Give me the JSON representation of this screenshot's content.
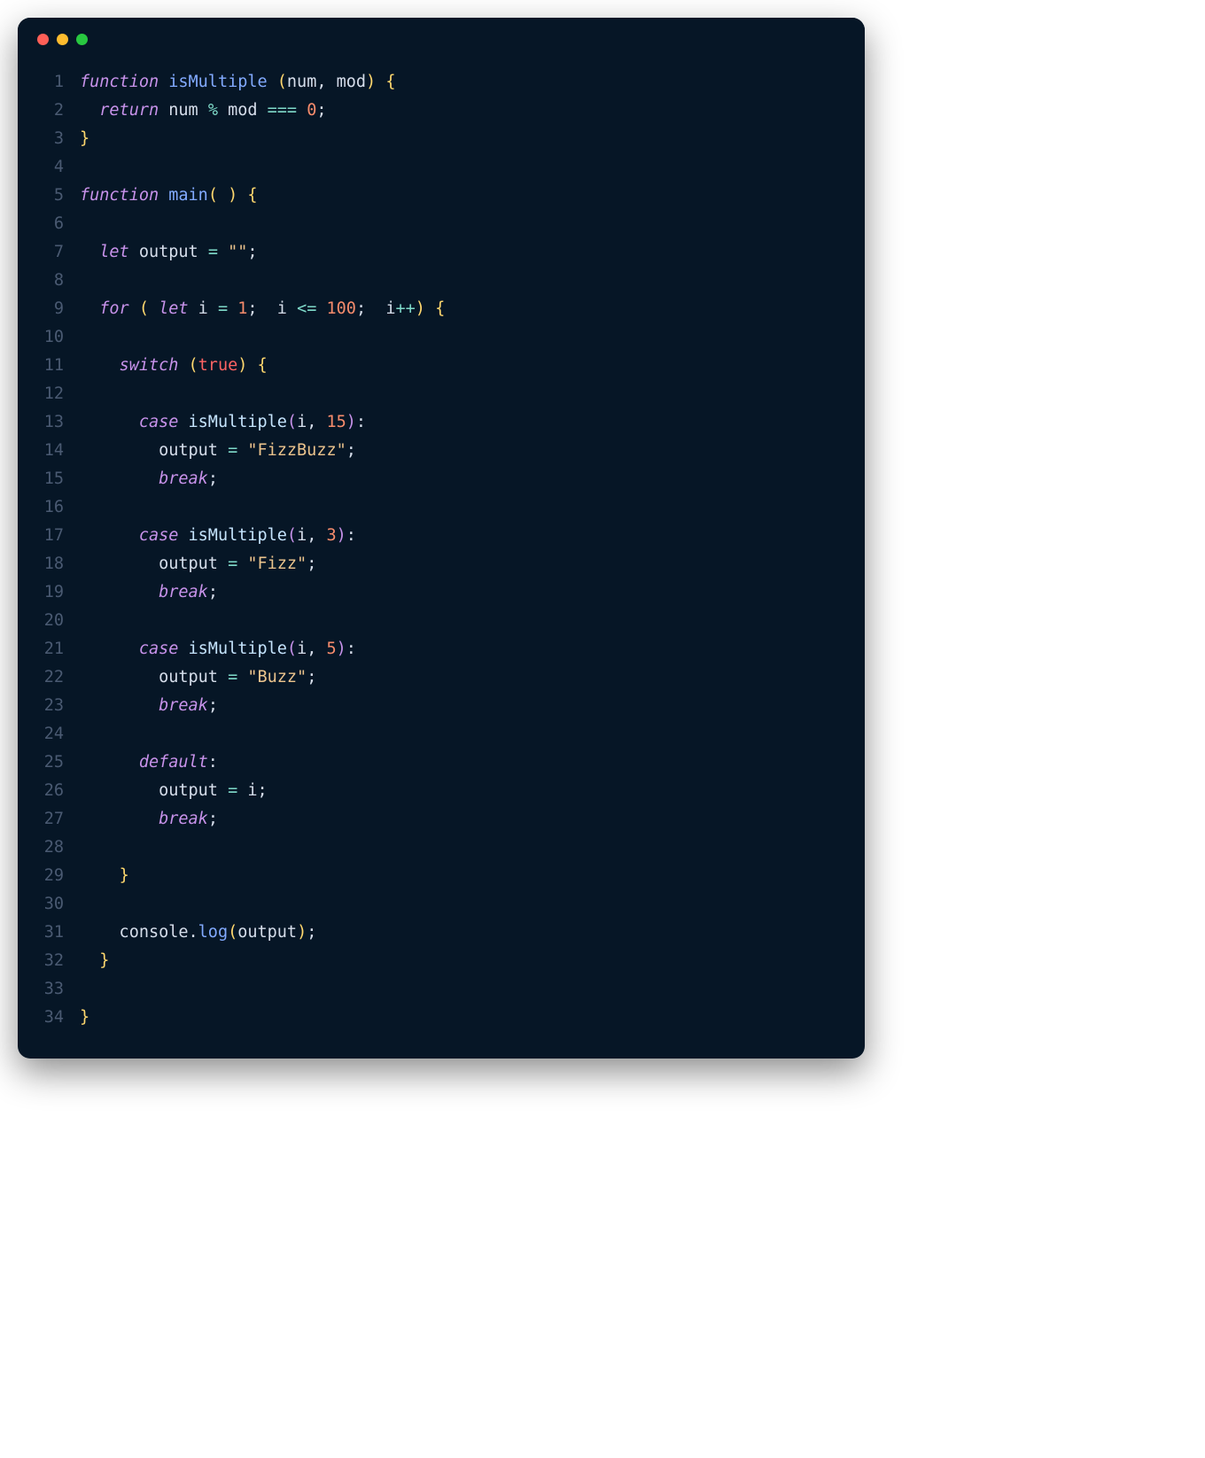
{
  "titlebar": {
    "buttons": [
      "close",
      "minimize",
      "zoom"
    ]
  },
  "code": {
    "language": "javascript",
    "lines": [
      {
        "n": 1,
        "tokens": [
          [
            "kw",
            "function"
          ],
          [
            "id",
            " "
          ],
          [
            "fn",
            "isMultiple"
          ],
          [
            "id",
            " "
          ],
          [
            "par",
            "("
          ],
          [
            "id",
            "num"
          ],
          [
            "punc",
            ", "
          ],
          [
            "id",
            "mod"
          ],
          [
            "par",
            ")"
          ],
          [
            "id",
            " "
          ],
          [
            "par",
            "{"
          ]
        ]
      },
      {
        "n": 2,
        "tokens": [
          [
            "id",
            "  "
          ],
          [
            "kw",
            "return"
          ],
          [
            "id",
            " num "
          ],
          [
            "op",
            "%"
          ],
          [
            "id",
            " mod "
          ],
          [
            "op",
            "==="
          ],
          [
            "id",
            " "
          ],
          [
            "num",
            "0"
          ],
          [
            "punc",
            ";"
          ]
        ]
      },
      {
        "n": 3,
        "tokens": [
          [
            "par",
            "}"
          ]
        ]
      },
      {
        "n": 4,
        "tokens": []
      },
      {
        "n": 5,
        "tokens": [
          [
            "kw",
            "function"
          ],
          [
            "id",
            " "
          ],
          [
            "fn",
            "main"
          ],
          [
            "par",
            "("
          ],
          [
            "id",
            " "
          ],
          [
            "par",
            ")"
          ],
          [
            "id",
            " "
          ],
          [
            "par",
            "{"
          ]
        ]
      },
      {
        "n": 6,
        "tokens": []
      },
      {
        "n": 7,
        "tokens": [
          [
            "id",
            "  "
          ],
          [
            "kw",
            "let"
          ],
          [
            "id",
            " output "
          ],
          [
            "op",
            "="
          ],
          [
            "id",
            " "
          ],
          [
            "str",
            "\"\""
          ],
          [
            "punc",
            ";"
          ]
        ]
      },
      {
        "n": 8,
        "tokens": []
      },
      {
        "n": 9,
        "tokens": [
          [
            "id",
            "  "
          ],
          [
            "kw",
            "for"
          ],
          [
            "id",
            " "
          ],
          [
            "par",
            "("
          ],
          [
            "id",
            " "
          ],
          [
            "kw",
            "let"
          ],
          [
            "id",
            " i "
          ],
          [
            "op",
            "="
          ],
          [
            "id",
            " "
          ],
          [
            "num",
            "1"
          ],
          [
            "punc",
            ";"
          ],
          [
            "id",
            "  i "
          ],
          [
            "op",
            "<="
          ],
          [
            "id",
            " "
          ],
          [
            "num",
            "100"
          ],
          [
            "punc",
            ";"
          ],
          [
            "id",
            "  i"
          ],
          [
            "op",
            "++"
          ],
          [
            "par",
            ")"
          ],
          [
            "id",
            " "
          ],
          [
            "par",
            "{"
          ]
        ]
      },
      {
        "n": 10,
        "tokens": []
      },
      {
        "n": 11,
        "tokens": [
          [
            "id",
            "    "
          ],
          [
            "kw",
            "switch"
          ],
          [
            "id",
            " "
          ],
          [
            "par",
            "("
          ],
          [
            "bool",
            "true"
          ],
          [
            "par",
            ")"
          ],
          [
            "id",
            " "
          ],
          [
            "par",
            "{"
          ]
        ]
      },
      {
        "n": 12,
        "tokens": []
      },
      {
        "n": 13,
        "tokens": [
          [
            "id",
            "      "
          ],
          [
            "kw",
            "case"
          ],
          [
            "id",
            " "
          ],
          [
            "call",
            "isMultiple"
          ],
          [
            "par2",
            "("
          ],
          [
            "id",
            "i"
          ],
          [
            "punc",
            ", "
          ],
          [
            "num",
            "15"
          ],
          [
            "par2",
            ")"
          ],
          [
            "punc",
            ":"
          ]
        ]
      },
      {
        "n": 14,
        "tokens": [
          [
            "id",
            "        output "
          ],
          [
            "op",
            "="
          ],
          [
            "id",
            " "
          ],
          [
            "str",
            "\"FizzBuzz\""
          ],
          [
            "punc",
            ";"
          ]
        ]
      },
      {
        "n": 15,
        "tokens": [
          [
            "id",
            "        "
          ],
          [
            "kw",
            "break"
          ],
          [
            "punc",
            ";"
          ]
        ]
      },
      {
        "n": 16,
        "tokens": []
      },
      {
        "n": 17,
        "tokens": [
          [
            "id",
            "      "
          ],
          [
            "kw",
            "case"
          ],
          [
            "id",
            " "
          ],
          [
            "call",
            "isMultiple"
          ],
          [
            "par2",
            "("
          ],
          [
            "id",
            "i"
          ],
          [
            "punc",
            ", "
          ],
          [
            "num",
            "3"
          ],
          [
            "par2",
            ")"
          ],
          [
            "punc",
            ":"
          ]
        ]
      },
      {
        "n": 18,
        "tokens": [
          [
            "id",
            "        output "
          ],
          [
            "op",
            "="
          ],
          [
            "id",
            " "
          ],
          [
            "str",
            "\"Fizz\""
          ],
          [
            "punc",
            ";"
          ]
        ]
      },
      {
        "n": 19,
        "tokens": [
          [
            "id",
            "        "
          ],
          [
            "kw",
            "break"
          ],
          [
            "punc",
            ";"
          ]
        ]
      },
      {
        "n": 20,
        "tokens": []
      },
      {
        "n": 21,
        "tokens": [
          [
            "id",
            "      "
          ],
          [
            "kw",
            "case"
          ],
          [
            "id",
            " "
          ],
          [
            "call",
            "isMultiple"
          ],
          [
            "par2",
            "("
          ],
          [
            "id",
            "i"
          ],
          [
            "punc",
            ", "
          ],
          [
            "num",
            "5"
          ],
          [
            "par2",
            ")"
          ],
          [
            "punc",
            ":"
          ]
        ]
      },
      {
        "n": 22,
        "tokens": [
          [
            "id",
            "        output "
          ],
          [
            "op",
            "="
          ],
          [
            "id",
            " "
          ],
          [
            "str",
            "\"Buzz\""
          ],
          [
            "punc",
            ";"
          ]
        ]
      },
      {
        "n": 23,
        "tokens": [
          [
            "id",
            "        "
          ],
          [
            "kw",
            "break"
          ],
          [
            "punc",
            ";"
          ]
        ]
      },
      {
        "n": 24,
        "tokens": []
      },
      {
        "n": 25,
        "tokens": [
          [
            "id",
            "      "
          ],
          [
            "kw",
            "default"
          ],
          [
            "punc",
            ":"
          ]
        ]
      },
      {
        "n": 26,
        "tokens": [
          [
            "id",
            "        output "
          ],
          [
            "op",
            "="
          ],
          [
            "id",
            " i"
          ],
          [
            "punc",
            ";"
          ]
        ]
      },
      {
        "n": 27,
        "tokens": [
          [
            "id",
            "        "
          ],
          [
            "kw",
            "break"
          ],
          [
            "punc",
            ";"
          ]
        ]
      },
      {
        "n": 28,
        "tokens": []
      },
      {
        "n": 29,
        "tokens": [
          [
            "id",
            "    "
          ],
          [
            "par",
            "}"
          ]
        ]
      },
      {
        "n": 30,
        "tokens": []
      },
      {
        "n": 31,
        "tokens": [
          [
            "id",
            "    console"
          ],
          [
            "punc",
            "."
          ],
          [
            "prop",
            "log"
          ],
          [
            "par",
            "("
          ],
          [
            "id",
            "output"
          ],
          [
            "par",
            ")"
          ],
          [
            "punc",
            ";"
          ]
        ]
      },
      {
        "n": 32,
        "tokens": [
          [
            "id",
            "  "
          ],
          [
            "par",
            "}"
          ]
        ]
      },
      {
        "n": 33,
        "tokens": []
      },
      {
        "n": 34,
        "tokens": [
          [
            "par",
            "}"
          ]
        ]
      }
    ]
  }
}
